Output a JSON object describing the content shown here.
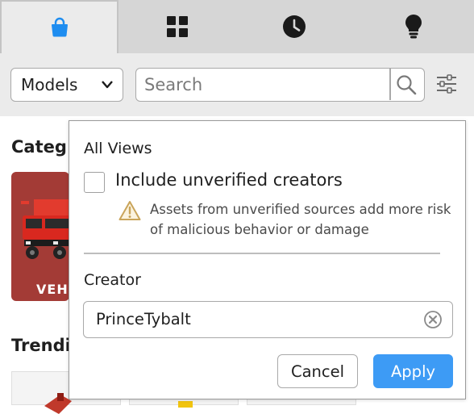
{
  "tabs": [
    {
      "icon": "shopping-bag-icon",
      "active": true
    },
    {
      "icon": "grid-icon",
      "active": false
    },
    {
      "icon": "clock-icon",
      "active": false
    },
    {
      "icon": "lightbulb-icon",
      "active": false
    }
  ],
  "toolbar": {
    "category_select": "Models",
    "search_placeholder": "Search"
  },
  "background": {
    "categories_title": "Categ",
    "card_label": "VEHI",
    "trending_title": "Trendi"
  },
  "filter_popover": {
    "heading": "All Views",
    "checkbox_label": "Include unverified creators",
    "checkbox_checked": false,
    "warning_text": "Assets from unverified sources add more risk of malicious behavior or damage",
    "creator_label": "Creator",
    "creator_value": "PrinceTybalt",
    "cancel_label": "Cancel",
    "apply_label": "Apply"
  },
  "colors": {
    "accent": "#3d9bf5",
    "active_tab_icon": "#1e8df0",
    "card_red": "#a33b36",
    "warning": "#c9a45a"
  }
}
